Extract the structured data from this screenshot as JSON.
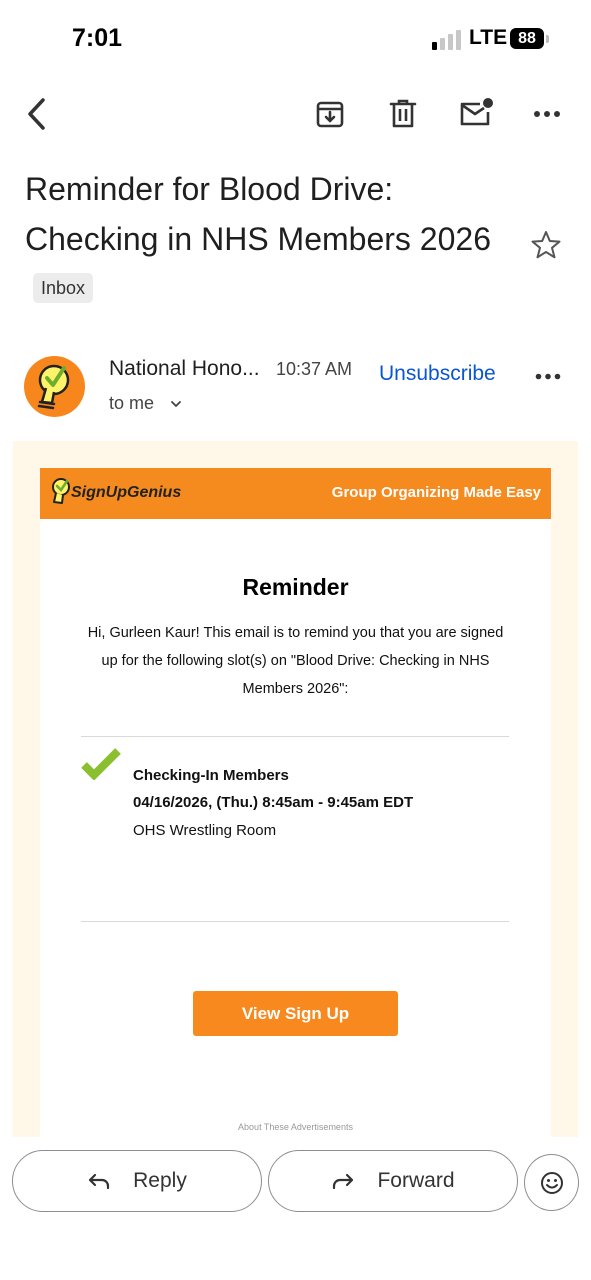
{
  "status_bar": {
    "time": "7:01",
    "network": "LTE",
    "battery": "88"
  },
  "toolbar": {
    "back": "back-arrow-icon",
    "archive": "archive-icon",
    "delete": "trash-icon",
    "mark_unread": "mail-unread-icon",
    "more": "more-horizontal-icon"
  },
  "email": {
    "subject": "Reminder for Blood Drive: Checking in NHS Members 2026",
    "label": "Inbox",
    "sender": "National Hono...",
    "time": "10:37 AM",
    "unsubscribe": "Unsubscribe",
    "recipient": "to me"
  },
  "body": {
    "brand": "SignUpGenius",
    "tagline": "Group Organizing Made Easy",
    "heading": "Reminder",
    "message": "Hi, Gurleen Kaur! This email is to remind you that you are signed up for the following slot(s) on \"Blood Drive: Checking in NHS Members 2026\":",
    "slot": {
      "name": "Checking-In Members",
      "datetime": "04/16/2026, (Thu.) 8:45am - 9:45am EDT",
      "location": "OHS Wrestling Room"
    },
    "cta": "View Sign Up",
    "ads_note": "About These Advertisements"
  },
  "actions": {
    "reply": "Reply",
    "forward": "Forward",
    "emoji": "emoji-reaction-icon"
  },
  "colors": {
    "brand_orange": "#f58a1f",
    "link_blue": "#0b57d0",
    "check_green": "#8cbf2f",
    "body_bg": "#fff7e8"
  }
}
